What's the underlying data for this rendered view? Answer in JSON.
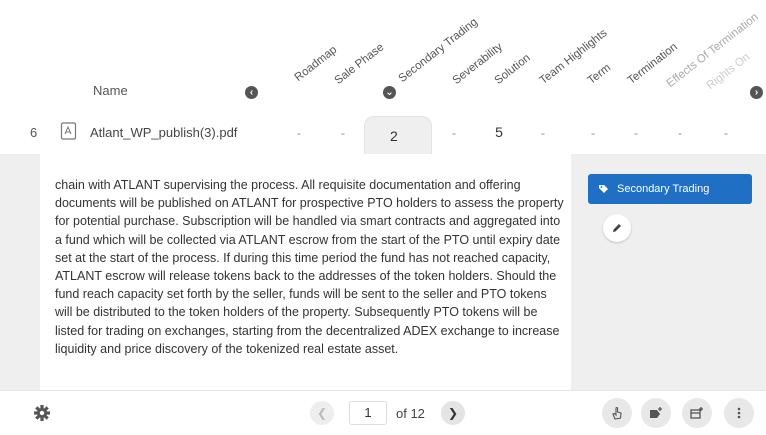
{
  "header": {
    "name_label": "Name",
    "columns": [
      "Roadmap",
      "Sale Phase",
      "Secondary Trading",
      "Severability",
      "Solution",
      "Team Highlights",
      "Term",
      "Termination",
      "Effects Of Termination",
      "Rights On"
    ]
  },
  "row": {
    "number": "6",
    "file_name": "Atlant_WP_publish(3).pdf",
    "cells": [
      "-",
      "-",
      "2",
      "-",
      "5",
      "-",
      "-",
      "-",
      "-",
      "-"
    ]
  },
  "content": {
    "text": "chain with ATLANT supervising the process. All requisite documentation and offering documents will be published on ATLANT for prospective PTO holders to assess the property for potential purchase. Subscription will be handled via smart contracts and aggregated into a fund which will be collected via ATLANT escrow from the start of the PTO until expiry date set at the start of the process. If during this time period the fund has not reached capacity, ATLANT escrow will release tokens back to the addresses of the token holders. Should the fund reach capacity set forth by the seller, funds will be sent to the seller and PTO tokens will be distributed to the token holders of the property. Subsequently PTO tokens will be listed for trading on exchanges, starting from the decentralized ADEX exchange to increase liquidity and price discovery of the tokenized real estate asset.",
    "tag_label": "Secondary Trading"
  },
  "pagination": {
    "current_page": "1",
    "of_label": "of 12"
  },
  "colors": {
    "accent": "#1f6fc5",
    "panel_bg": "#efefef"
  },
  "icons": [
    "sort-circle-icon",
    "sort-down-icon",
    "pdf-file-icon",
    "tag-icon",
    "pencil-icon",
    "gear-icon",
    "chevron-left-icon",
    "chevron-right-icon",
    "hand-pointer-icon",
    "add-tag-icon",
    "add-column-icon",
    "more-vertical-icon"
  ]
}
